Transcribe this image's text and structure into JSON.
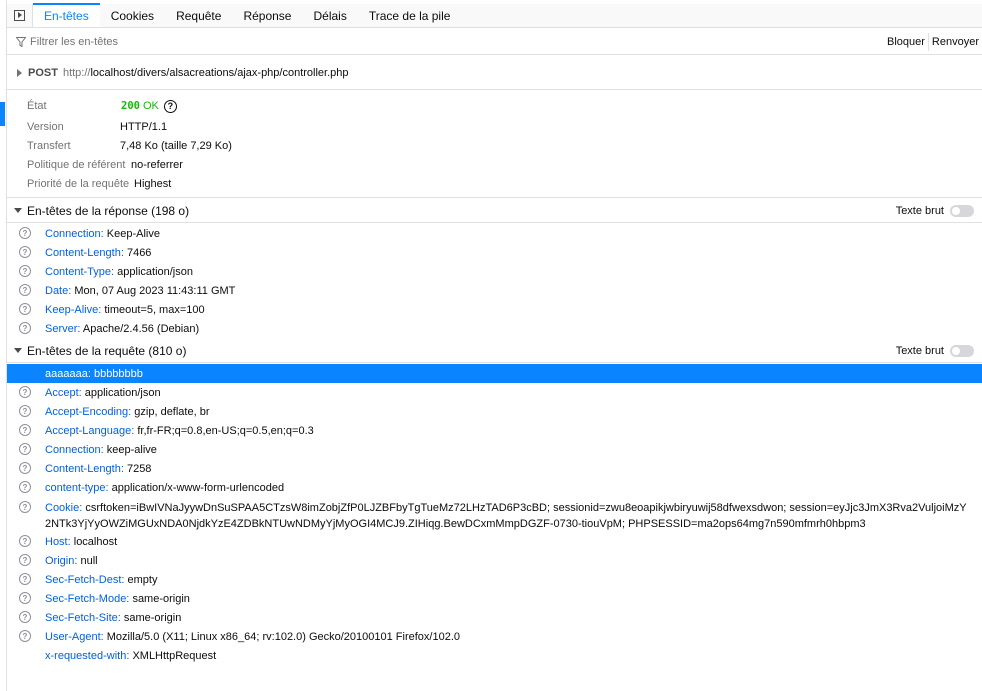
{
  "tabs": [
    {
      "label": "En-têtes",
      "active": true
    },
    {
      "label": "Cookies"
    },
    {
      "label": "Requête"
    },
    {
      "label": "Réponse"
    },
    {
      "label": "Délais"
    },
    {
      "label": "Trace de la pile"
    }
  ],
  "filter": {
    "placeholder": "Filtrer les en-têtes",
    "block_label": "Bloquer",
    "resend_label": "Renvoyer"
  },
  "request_line": {
    "method": "POST",
    "url_scheme": "http://",
    "url_rest": "localhost/divers/alsacreations/ajax-php/controller.php"
  },
  "summary": {
    "status_label": "État",
    "status_code": "200",
    "status_text": "OK",
    "version_label": "Version",
    "version_value": "HTTP/1.1",
    "transfer_label": "Transfert",
    "transfer_value": "7,48 Ko (taille 7,29 Ko)",
    "referrer_label": "Politique de référent",
    "referrer_value": "no-referrer",
    "priority_label": "Priorité de la requête",
    "priority_value": "Highest"
  },
  "response_headers": {
    "title": "En-têtes de la réponse (198 o)",
    "raw_label": "Texte brut",
    "items": [
      {
        "name": "Connection:",
        "value": "Keep-Alive"
      },
      {
        "name": "Content-Length:",
        "value": "7466"
      },
      {
        "name": "Content-Type:",
        "value": "application/json"
      },
      {
        "name": "Date:",
        "value": "Mon, 07 Aug 2023 11:43:11 GMT"
      },
      {
        "name": "Keep-Alive:",
        "value": "timeout=5, max=100"
      },
      {
        "name": "Server:",
        "value": "Apache/2.4.56 (Debian)"
      }
    ]
  },
  "request_headers": {
    "title": "En-têtes de la requête (810 o)",
    "raw_label": "Texte brut",
    "items": [
      {
        "name": "aaaaaaa:",
        "value": "bbbbbbbb"
      },
      {
        "name": "Accept:",
        "value": "application/json"
      },
      {
        "name": "Accept-Encoding:",
        "value": "gzip, deflate, br"
      },
      {
        "name": "Accept-Language:",
        "value": "fr,fr-FR;q=0.8,en-US;q=0.5,en;q=0.3"
      },
      {
        "name": "Connection:",
        "value": "keep-alive"
      },
      {
        "name": "Content-Length:",
        "value": "7258"
      },
      {
        "name": "content-type:",
        "value": "application/x-www-form-urlencoded"
      },
      {
        "name": "Cookie:",
        "value": "csrftoken=iBwIVNaJyywDnSuSPAA5CTzsW8imZobjZfP0LJZBFbyTgTueMz72LHzTAD6P3cBD; sessionid=zwu8eoapikjwbiryuwij58dfwexsdwon; session=eyJjc3JmX3Rva2VuljoiMzY2NTk3YjYyOWZiMGUxNDA0NjdkYzE4ZDBkNTUwNDMyYjMyOGI4MCJ9.ZIHiqg.BewDCxmMmpDGZF-0730-tiouVpM; PHPSESSID=ma2ops64mg7n590mfmrh0hbpm3"
      },
      {
        "name": "Host:",
        "value": "localhost"
      },
      {
        "name": "Origin:",
        "value": "null"
      },
      {
        "name": "Sec-Fetch-Dest:",
        "value": "empty"
      },
      {
        "name": "Sec-Fetch-Mode:",
        "value": "same-origin"
      },
      {
        "name": "Sec-Fetch-Site:",
        "value": "same-origin"
      },
      {
        "name": "User-Agent:",
        "value": "Mozilla/5.0 (X11; Linux x86_64; rv:102.0) Gecko/20100101 Firefox/102.0"
      },
      {
        "name": "x-requested-with:",
        "value": "XMLHttpRequest"
      }
    ]
  },
  "help_glyph": "?",
  "colors": {
    "accent": "#0a84ff",
    "header_name": "#0060df",
    "status_ok": "#12bc00"
  }
}
